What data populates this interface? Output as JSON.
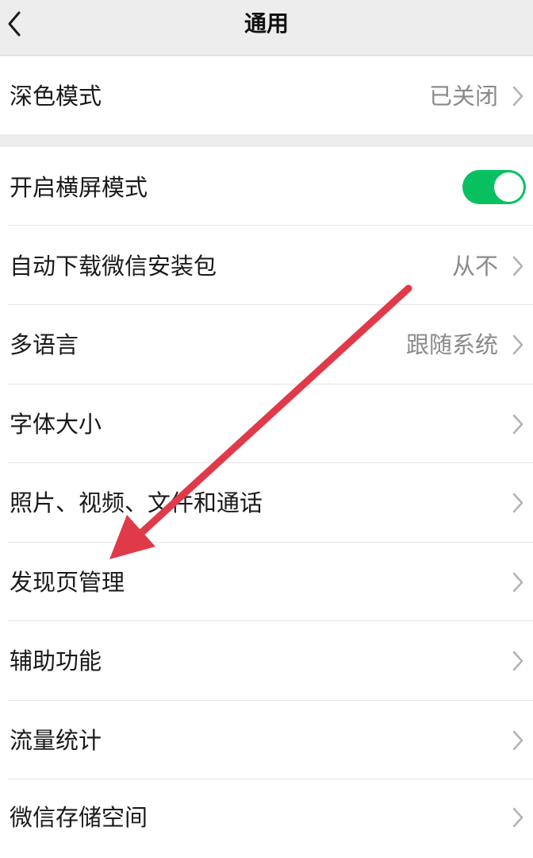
{
  "header": {
    "title": "通用",
    "back_icon": "chevron-left-icon"
  },
  "dark_mode": {
    "label": "深色模式",
    "value": "已关闭"
  },
  "settings": {
    "landscape": {
      "label": "开启横屏模式",
      "toggle_on": true,
      "toggle_color": "#07c160"
    },
    "auto_download": {
      "label": "自动下载微信安装包",
      "value": "从不"
    },
    "language": {
      "label": "多语言",
      "value": "跟随系统"
    },
    "font_size": {
      "label": "字体大小"
    },
    "media": {
      "label": "照片、视频、文件和通话"
    },
    "discover": {
      "label": "发现页管理"
    },
    "accessibility": {
      "label": "辅助功能"
    },
    "traffic": {
      "label": "流量统计"
    },
    "storage": {
      "label": "微信存储空间"
    }
  },
  "annotation": {
    "icon": "red-arrow-annotation",
    "color": "#e03a4a"
  }
}
